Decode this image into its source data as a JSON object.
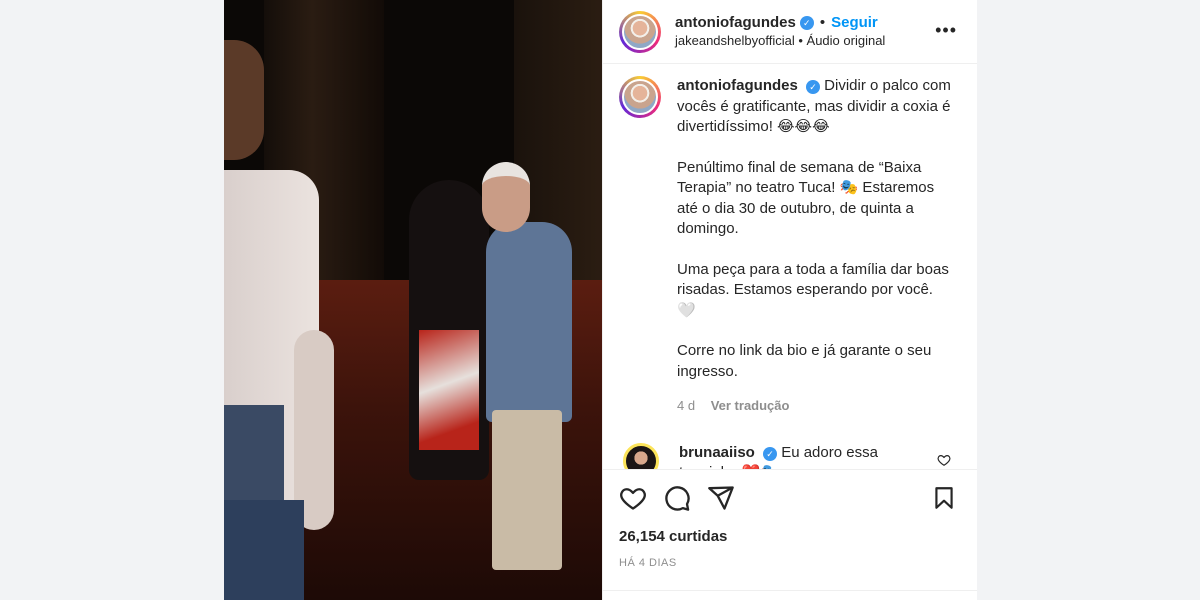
{
  "header": {
    "username": "antoniofagundes",
    "follow_label": "Seguir",
    "audio_source": "jakeandshelbyofficial",
    "audio_label": "Áudio original",
    "more_label": "•••"
  },
  "caption": {
    "username": "antoniofagundes",
    "paragraphs": [
      "Dividir o palco com vocês é gratificante, mas dividir a coxia é divertidíssimo! 😂😂😂",
      "Penúltimo final de semana de “Baixa Terapia” no teatro Tuca! 🎭 Estaremos até o dia 30 de outubro, de quinta a domingo.",
      "Uma peça para a toda a família dar boas risadas. Estamos esperando por você. 🤍",
      "Corre no link da bio e já garante o seu ingresso."
    ],
    "age": "4 d",
    "translate_label": "Ver tradução"
  },
  "comment": {
    "username": "brunaaiiso",
    "text": "Eu adoro essa turminha ❤️🎭"
  },
  "footer": {
    "likes": "26,154 curtidas",
    "date": "HÁ 4 DIAS"
  },
  "colors": {
    "accent": "#0095f6",
    "verified": "#3897f0",
    "muted": "#8e8e8e"
  }
}
